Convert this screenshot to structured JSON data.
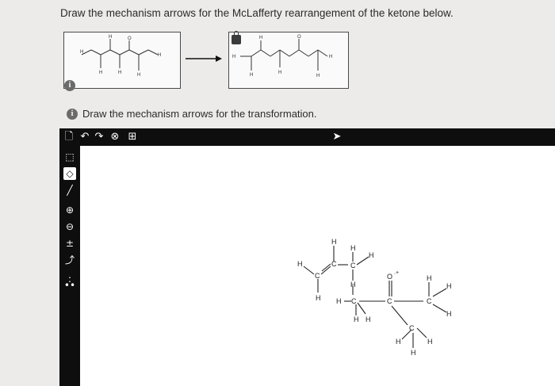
{
  "question": {
    "title": "Draw the mechanism arrows for the McLafferty rearrangement of the ketone below."
  },
  "step": {
    "instruction": "Draw the mechanism arrows for the transformation.",
    "info_icon": "i"
  },
  "toolbar": {
    "icons": [
      "new-document-icon",
      "undo-icon",
      "redo-icon",
      "zoom-reset-icon",
      "periodic-table-icon",
      "pointer-cursor-icon"
    ]
  },
  "sidebar": {
    "tools": [
      "select-lasso-icon",
      "eraser-icon",
      "single-bond-icon",
      "positive-charge-icon",
      "negative-charge-icon",
      "lone-pair-add-icon",
      "curved-arrow-icon",
      "radical-icon",
      "lone-pair-icon"
    ],
    "selected_tool": "eraser-icon"
  },
  "atom_labels": {
    "H": "H",
    "C": "C",
    "O": "O",
    "radical_cation": ".+"
  },
  "colors": {
    "toolbar_bg": "#0e0e0e",
    "page_bg": "#ecebea",
    "canvas_bg": "#ffffff"
  }
}
